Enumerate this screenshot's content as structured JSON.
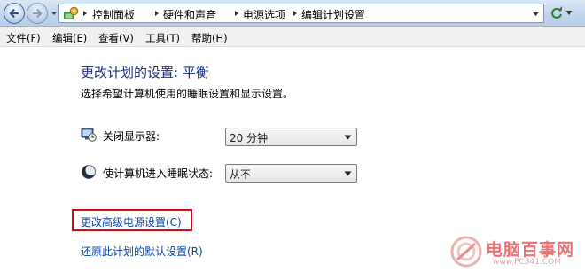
{
  "breadcrumb": {
    "items": [
      "控制面板",
      "硬件和声音",
      "电源选项",
      "编辑计划设置"
    ]
  },
  "menu": {
    "items": [
      "文件(F)",
      "编辑(E)",
      "查看(V)",
      "工具(T)",
      "帮助(H)"
    ]
  },
  "page": {
    "title": "更改计划的设置: 平衡",
    "description": "选择希望计算机使用的睡眠设置和显示设置。"
  },
  "settings": {
    "display_off": {
      "label": "关闭显示器:",
      "value": "20 分钟",
      "icon": "monitor-clock-icon"
    },
    "sleep": {
      "label": "使计算机进入睡眠状态:",
      "value": "从不",
      "icon": "moon-icon"
    }
  },
  "links": {
    "advanced": "更改高级电源设置(C)",
    "restore": "还原此计划的默认设置(R)"
  },
  "watermark": {
    "text": "电脑百事网",
    "url": "www.PC841.COM",
    "logo": "pc-logo"
  },
  "colors": {
    "title": "#1e3287",
    "link": "#0645ad",
    "highlight": "#d40c16"
  }
}
